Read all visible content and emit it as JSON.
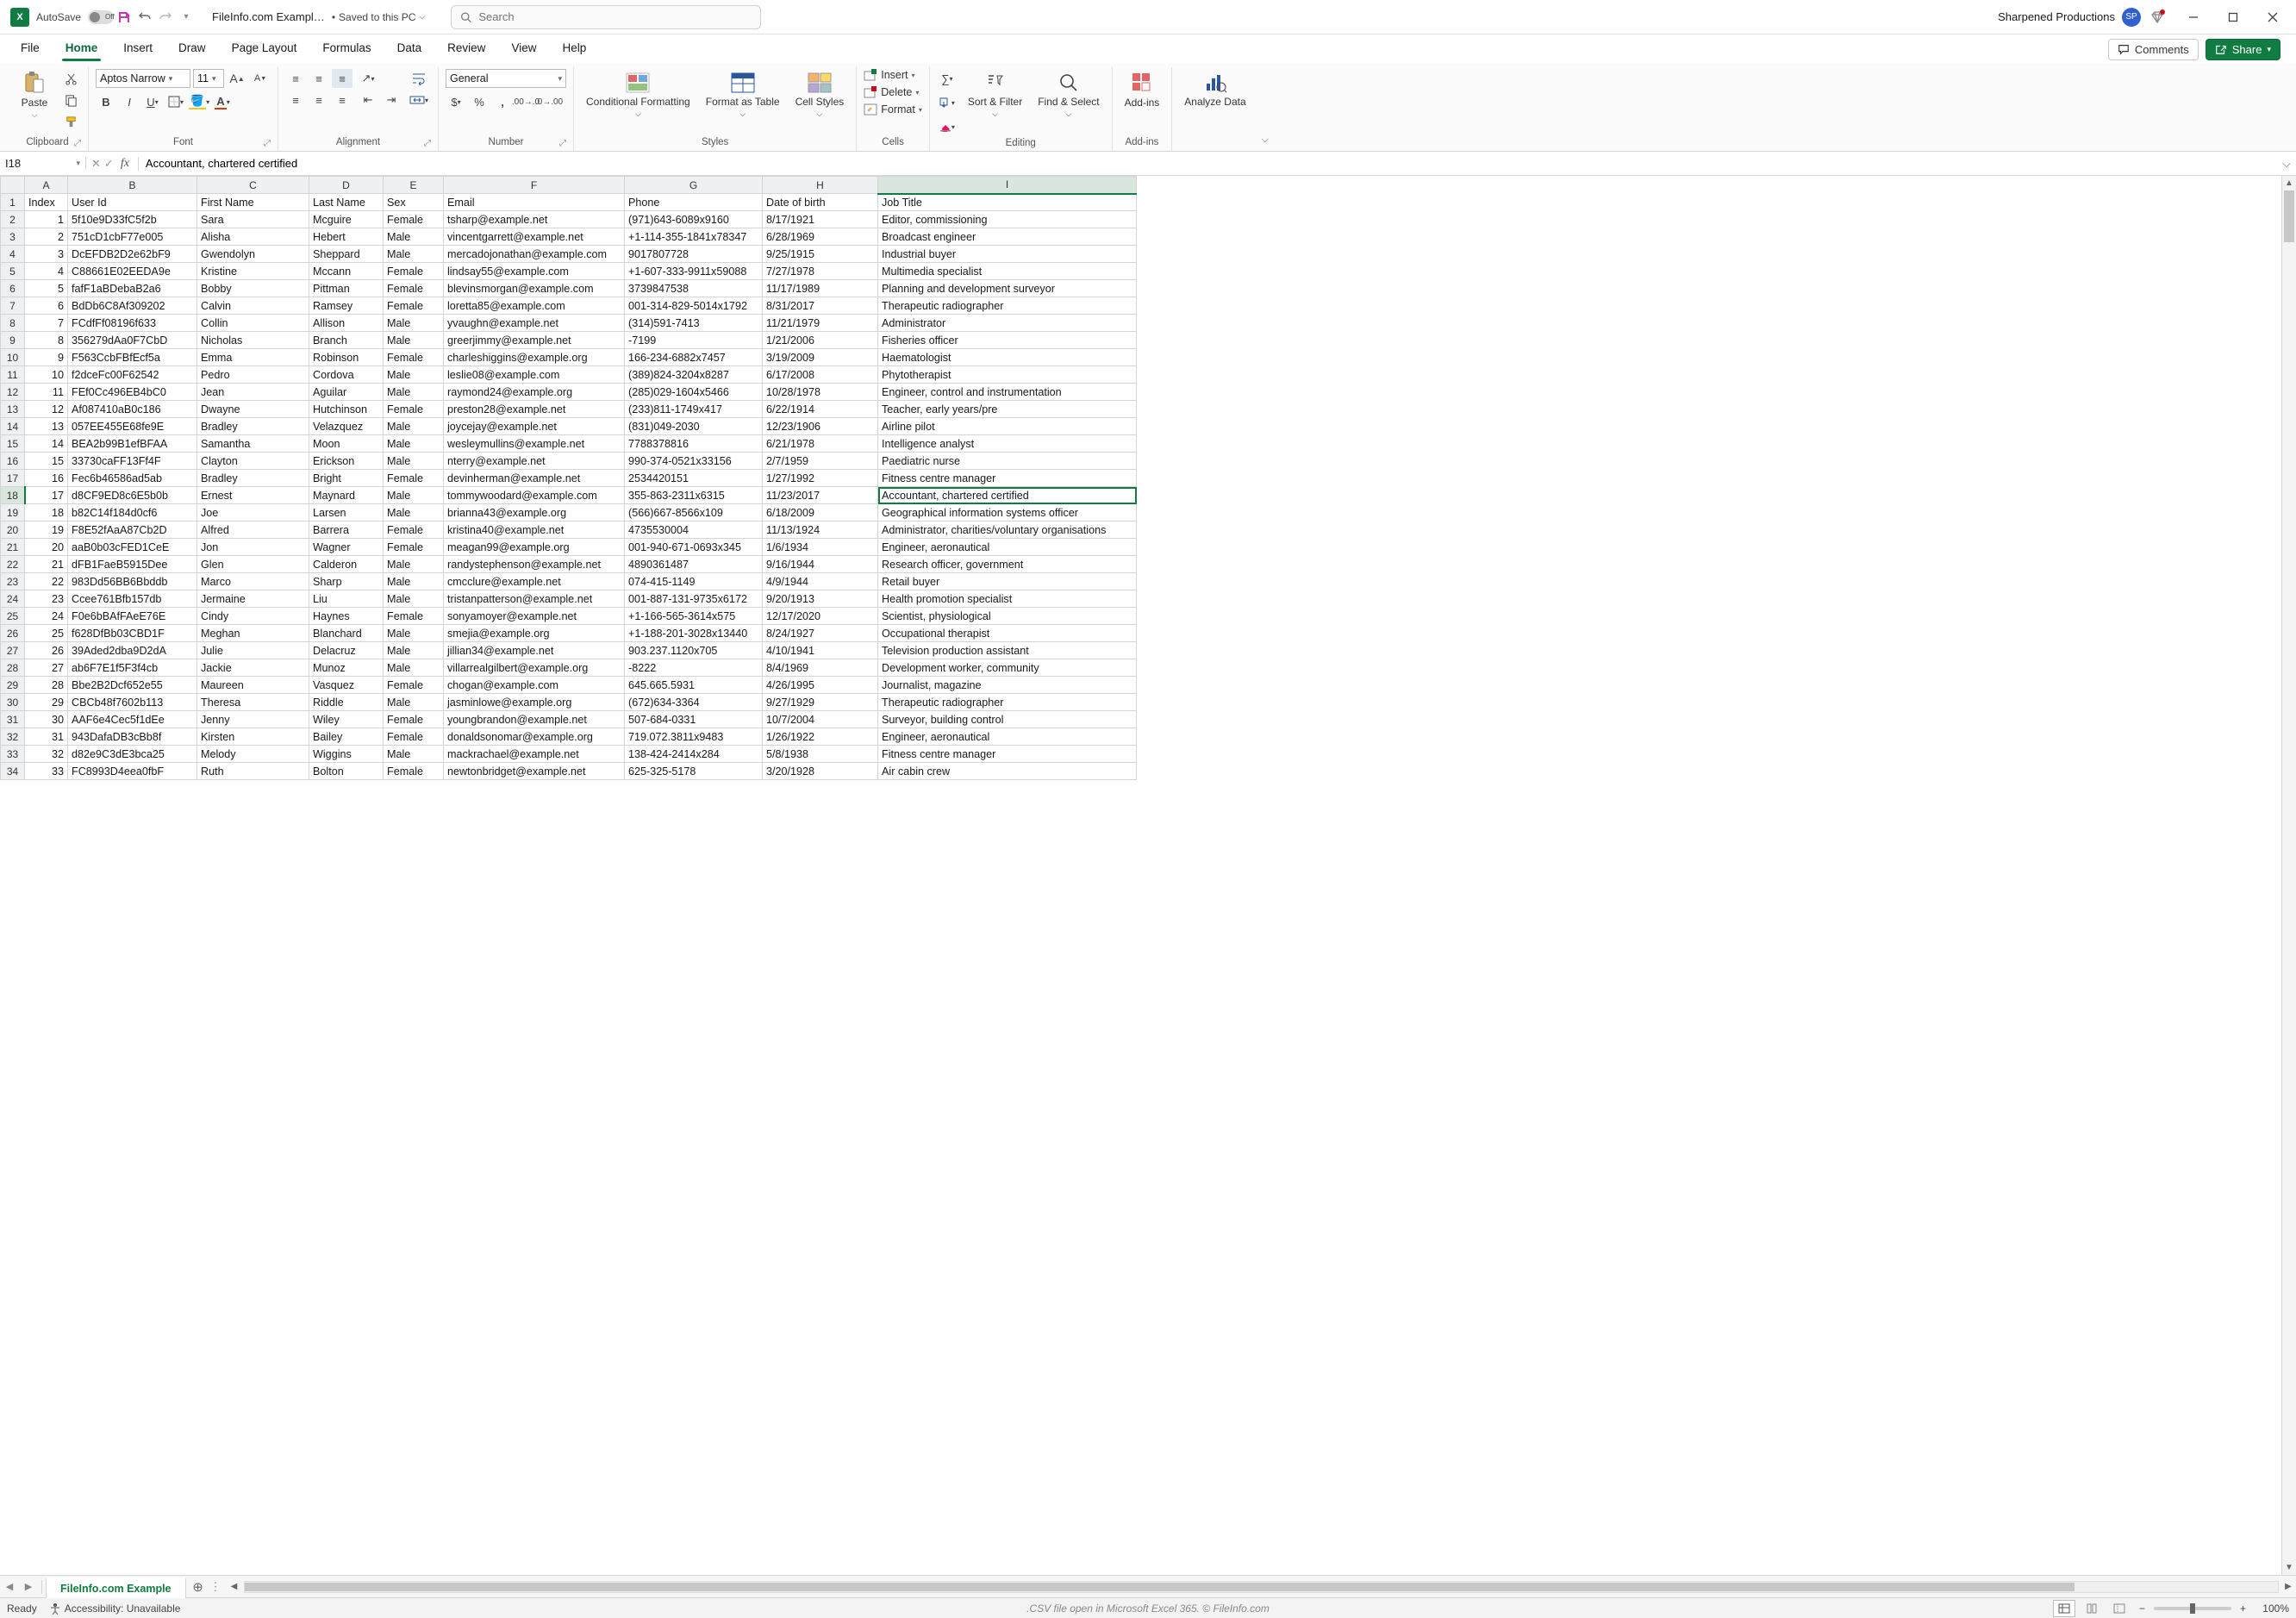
{
  "titlebar": {
    "autosave_label": "AutoSave",
    "autosave_off": "Off",
    "filename": "FileInfo.com Exampl…",
    "saved_status": "Saved to this PC",
    "search_placeholder": "Search",
    "account_name": "Sharpened Productions",
    "account_initials": "SP"
  },
  "tabs": {
    "file": "File",
    "home": "Home",
    "insert": "Insert",
    "draw": "Draw",
    "page_layout": "Page Layout",
    "formulas": "Formulas",
    "data": "Data",
    "review": "Review",
    "view": "View",
    "help": "Help",
    "comments": "Comments",
    "share": "Share"
  },
  "ribbon": {
    "clipboard": {
      "paste": "Paste",
      "label": "Clipboard"
    },
    "font": {
      "name": "Aptos Narrow",
      "size": "11",
      "label": "Font"
    },
    "alignment": {
      "label": "Alignment"
    },
    "number": {
      "format": "General",
      "label": "Number"
    },
    "styles": {
      "conditional": "Conditional Formatting",
      "format_table": "Format as Table",
      "cell_styles": "Cell Styles",
      "label": "Styles"
    },
    "cells": {
      "insert": "Insert",
      "delete": "Delete",
      "format": "Format",
      "label": "Cells"
    },
    "editing": {
      "sort": "Sort & Filter",
      "find": "Find & Select",
      "label": "Editing"
    },
    "addins": {
      "btn": "Add-ins",
      "label": "Add-ins"
    },
    "analyze": {
      "btn": "Analyze Data"
    }
  },
  "fx": {
    "namebox": "I18",
    "formula": "Accountant, chartered certified"
  },
  "columns": [
    "A",
    "B",
    "C",
    "D",
    "E",
    "F",
    "G",
    "H",
    "I"
  ],
  "headers": [
    "Index",
    "User Id",
    "First Name",
    "Last Name",
    "Sex",
    "Email",
    "Phone",
    "Date of birth",
    "Job Title"
  ],
  "active_cell": {
    "row": 18,
    "col": "I"
  },
  "rows": [
    {
      "n": 1,
      "Index": "1",
      "UserId": "5f10e9D33fC5f2b",
      "FirstName": "Sara",
      "LastName": "Mcguire",
      "Sex": "Female",
      "Email": "tsharp@example.net",
      "Phone": "(971)643-6089x9160",
      "DOB": "8/17/1921",
      "JobTitle": "Editor, commissioning"
    },
    {
      "n": 2,
      "Index": "2",
      "UserId": "751cD1cbF77e005",
      "FirstName": "Alisha",
      "LastName": "Hebert",
      "Sex": "Male",
      "Email": "vincentgarrett@example.net",
      "Phone": "+1-114-355-1841x78347",
      "DOB": "6/28/1969",
      "JobTitle": "Broadcast engineer"
    },
    {
      "n": 3,
      "Index": "3",
      "UserId": "DcEFDB2D2e62bF9",
      "FirstName": "Gwendolyn",
      "LastName": "Sheppard",
      "Sex": "Male",
      "Email": "mercadojonathan@example.com",
      "Phone": "9017807728",
      "DOB": "9/25/1915",
      "JobTitle": "Industrial buyer"
    },
    {
      "n": 4,
      "Index": "4",
      "UserId": "C88661E02EEDA9e",
      "FirstName": "Kristine",
      "LastName": "Mccann",
      "Sex": "Female",
      "Email": "lindsay55@example.com",
      "Phone": "+1-607-333-9911x59088",
      "DOB": "7/27/1978",
      "JobTitle": "Multimedia specialist"
    },
    {
      "n": 5,
      "Index": "5",
      "UserId": "fafF1aBDebaB2a6",
      "FirstName": "Bobby",
      "LastName": "Pittman",
      "Sex": "Female",
      "Email": "blevinsmorgan@example.com",
      "Phone": "3739847538",
      "DOB": "11/17/1989",
      "JobTitle": "Planning and development surveyor"
    },
    {
      "n": 6,
      "Index": "6",
      "UserId": "BdDb6C8Af309202",
      "FirstName": "Calvin",
      "LastName": "Ramsey",
      "Sex": "Female",
      "Email": "loretta85@example.com",
      "Phone": "001-314-829-5014x1792",
      "DOB": "8/31/2017",
      "JobTitle": "Therapeutic radiographer"
    },
    {
      "n": 7,
      "Index": "7",
      "UserId": "FCdfFf08196f633",
      "FirstName": "Collin",
      "LastName": "Allison",
      "Sex": "Male",
      "Email": "yvaughn@example.net",
      "Phone": "(314)591-7413",
      "DOB": "11/21/1979",
      "JobTitle": "Administrator"
    },
    {
      "n": 8,
      "Index": "8",
      "UserId": "356279dAa0F7CbD",
      "FirstName": "Nicholas",
      "LastName": "Branch",
      "Sex": "Male",
      "Email": "greerjimmy@example.net",
      "Phone": "-7199",
      "DOB": "1/21/2006",
      "JobTitle": "Fisheries officer"
    },
    {
      "n": 9,
      "Index": "9",
      "UserId": "F563CcbFBfEcf5a",
      "FirstName": "Emma",
      "LastName": "Robinson",
      "Sex": "Female",
      "Email": "charleshiggins@example.org",
      "Phone": "166-234-6882x7457",
      "DOB": "3/19/2009",
      "JobTitle": "Haematologist"
    },
    {
      "n": 10,
      "Index": "10",
      "UserId": "f2dceFc00F62542",
      "FirstName": "Pedro",
      "LastName": "Cordova",
      "Sex": "Male",
      "Email": "leslie08@example.com",
      "Phone": "(389)824-3204x8287",
      "DOB": "6/17/2008",
      "JobTitle": "Phytotherapist"
    },
    {
      "n": 11,
      "Index": "11",
      "UserId": "FEf0Cc496EB4bC0",
      "FirstName": "Jean",
      "LastName": "Aguilar",
      "Sex": "Male",
      "Email": "raymond24@example.org",
      "Phone": "(285)029-1604x5466",
      "DOB": "10/28/1978",
      "JobTitle": "Engineer, control and instrumentation"
    },
    {
      "n": 12,
      "Index": "12",
      "UserId": "Af087410aB0c186",
      "FirstName": "Dwayne",
      "LastName": "Hutchinson",
      "Sex": "Female",
      "Email": "preston28@example.net",
      "Phone": "(233)811-1749x417",
      "DOB": "6/22/1914",
      "JobTitle": "Teacher, early years/pre"
    },
    {
      "n": 13,
      "Index": "13",
      "UserId": "057EE455E68fe9E",
      "FirstName": "Bradley",
      "LastName": "Velazquez",
      "Sex": "Male",
      "Email": "joycejay@example.net",
      "Phone": "(831)049-2030",
      "DOB": "12/23/1906",
      "JobTitle": "Airline pilot"
    },
    {
      "n": 14,
      "Index": "14",
      "UserId": "BEA2b99B1efBFAA",
      "FirstName": "Samantha",
      "LastName": "Moon",
      "Sex": "Male",
      "Email": "wesleymullins@example.net",
      "Phone": "7788378816",
      "DOB": "6/21/1978",
      "JobTitle": "Intelligence analyst"
    },
    {
      "n": 15,
      "Index": "15",
      "UserId": "33730caFF13Ff4F",
      "FirstName": "Clayton",
      "LastName": "Erickson",
      "Sex": "Male",
      "Email": "nterry@example.net",
      "Phone": "990-374-0521x33156",
      "DOB": "2/7/1959",
      "JobTitle": "Paediatric nurse"
    },
    {
      "n": 16,
      "Index": "16",
      "UserId": "Fec6b46586ad5ab",
      "FirstName": "Bradley",
      "LastName": "Bright",
      "Sex": "Female",
      "Email": "devinherman@example.net",
      "Phone": "2534420151",
      "DOB": "1/27/1992",
      "JobTitle": "Fitness centre manager"
    },
    {
      "n": 17,
      "Index": "17",
      "UserId": "d8CF9ED8c6E5b0b",
      "FirstName": "Ernest",
      "LastName": "Maynard",
      "Sex": "Male",
      "Email": "tommywoodard@example.com",
      "Phone": "355-863-2311x6315",
      "DOB": "11/23/2017",
      "JobTitle": "Accountant, chartered certified"
    },
    {
      "n": 18,
      "Index": "18",
      "UserId": "b82C14f184d0cf6",
      "FirstName": "Joe",
      "LastName": "Larsen",
      "Sex": "Male",
      "Email": "brianna43@example.org",
      "Phone": "(566)667-8566x109",
      "DOB": "6/18/2009",
      "JobTitle": "Geographical information systems officer"
    },
    {
      "n": 19,
      "Index": "19",
      "UserId": "F8E52fAaA87Cb2D",
      "FirstName": "Alfred",
      "LastName": "Barrera",
      "Sex": "Female",
      "Email": "kristina40@example.net",
      "Phone": "4735530004",
      "DOB": "11/13/1924",
      "JobTitle": "Administrator, charities/voluntary organisations"
    },
    {
      "n": 20,
      "Index": "20",
      "UserId": "aaB0b03cFED1CeE",
      "FirstName": "Jon",
      "LastName": "Wagner",
      "Sex": "Female",
      "Email": "meagan99@example.org",
      "Phone": "001-940-671-0693x345",
      "DOB": "1/6/1934",
      "JobTitle": "Engineer, aeronautical"
    },
    {
      "n": 21,
      "Index": "21",
      "UserId": "dFB1FaeB5915Dee",
      "FirstName": "Glen",
      "LastName": "Calderon",
      "Sex": "Male",
      "Email": "randystephenson@example.net",
      "Phone": "4890361487",
      "DOB": "9/16/1944",
      "JobTitle": "Research officer, government"
    },
    {
      "n": 22,
      "Index": "22",
      "UserId": "983Dd56BB6Bbddb",
      "FirstName": "Marco",
      "LastName": "Sharp",
      "Sex": "Male",
      "Email": "cmcclure@example.net",
      "Phone": "074-415-1149",
      "DOB": "4/9/1944",
      "JobTitle": "Retail buyer"
    },
    {
      "n": 23,
      "Index": "23",
      "UserId": "Ccee761Bfb157db",
      "FirstName": "Jermaine",
      "LastName": "Liu",
      "Sex": "Male",
      "Email": "tristanpatterson@example.net",
      "Phone": "001-887-131-9735x6172",
      "DOB": "9/20/1913",
      "JobTitle": "Health promotion specialist"
    },
    {
      "n": 24,
      "Index": "24",
      "UserId": "F0e6bBAfFAeE76E",
      "FirstName": "Cindy",
      "LastName": "Haynes",
      "Sex": "Female",
      "Email": "sonyamoyer@example.net",
      "Phone": "+1-166-565-3614x575",
      "DOB": "12/17/2020",
      "JobTitle": "Scientist, physiological"
    },
    {
      "n": 25,
      "Index": "25",
      "UserId": "f628DfBb03CBD1F",
      "FirstName": "Meghan",
      "LastName": "Blanchard",
      "Sex": "Male",
      "Email": "smejia@example.org",
      "Phone": "+1-188-201-3028x13440",
      "DOB": "8/24/1927",
      "JobTitle": "Occupational therapist"
    },
    {
      "n": 26,
      "Index": "26",
      "UserId": "39Aded2dba9D2dA",
      "FirstName": "Julie",
      "LastName": "Delacruz",
      "Sex": "Male",
      "Email": "jillian34@example.net",
      "Phone": "903.237.1120x705",
      "DOB": "4/10/1941",
      "JobTitle": "Television production assistant"
    },
    {
      "n": 27,
      "Index": "27",
      "UserId": "ab6F7E1f5F3f4cb",
      "FirstName": "Jackie",
      "LastName": "Munoz",
      "Sex": "Male",
      "Email": "villarrealgilbert@example.org",
      "Phone": "-8222",
      "DOB": "8/4/1969",
      "JobTitle": "Development worker, community"
    },
    {
      "n": 28,
      "Index": "28",
      "UserId": "Bbe2B2Dcf652e55",
      "FirstName": "Maureen",
      "LastName": "Vasquez",
      "Sex": "Female",
      "Email": "chogan@example.com",
      "Phone": "645.665.5931",
      "DOB": "4/26/1995",
      "JobTitle": "Journalist, magazine"
    },
    {
      "n": 29,
      "Index": "29",
      "UserId": "CBCb48f7602b113",
      "FirstName": "Theresa",
      "LastName": "Riddle",
      "Sex": "Male",
      "Email": "jasminlowe@example.org",
      "Phone": "(672)634-3364",
      "DOB": "9/27/1929",
      "JobTitle": "Therapeutic radiographer"
    },
    {
      "n": 30,
      "Index": "30",
      "UserId": "AAF6e4Cec5f1dEe",
      "FirstName": "Jenny",
      "LastName": "Wiley",
      "Sex": "Female",
      "Email": "youngbrandon@example.net",
      "Phone": "507-684-0331",
      "DOB": "10/7/2004",
      "JobTitle": "Surveyor, building control"
    },
    {
      "n": 31,
      "Index": "31",
      "UserId": "943DafaDB3cBb8f",
      "FirstName": "Kirsten",
      "LastName": "Bailey",
      "Sex": "Female",
      "Email": "donaldsonomar@example.org",
      "Phone": "719.072.3811x9483",
      "DOB": "1/26/1922",
      "JobTitle": "Engineer, aeronautical"
    },
    {
      "n": 32,
      "Index": "32",
      "UserId": "d82e9C3dE3bca25",
      "FirstName": "Melody",
      "LastName": "Wiggins",
      "Sex": "Male",
      "Email": "mackrachael@example.net",
      "Phone": "138-424-2414x284",
      "DOB": "5/8/1938",
      "JobTitle": "Fitness centre manager"
    },
    {
      "n": 33,
      "Index": "33",
      "UserId": "FC8993D4eea0fbF",
      "FirstName": "Ruth",
      "LastName": "Bolton",
      "Sex": "Female",
      "Email": "newtonbridget@example.net",
      "Phone": "625-325-5178",
      "DOB": "3/20/1928",
      "JobTitle": "Air cabin crew"
    }
  ],
  "sheet_tab": "FileInfo.com Example",
  "status": {
    "ready": "Ready",
    "accessibility": "Accessibility: Unavailable",
    "footer": ".CSV file open in Microsoft Excel 365. © FileInfo.com",
    "zoom": "100%"
  }
}
